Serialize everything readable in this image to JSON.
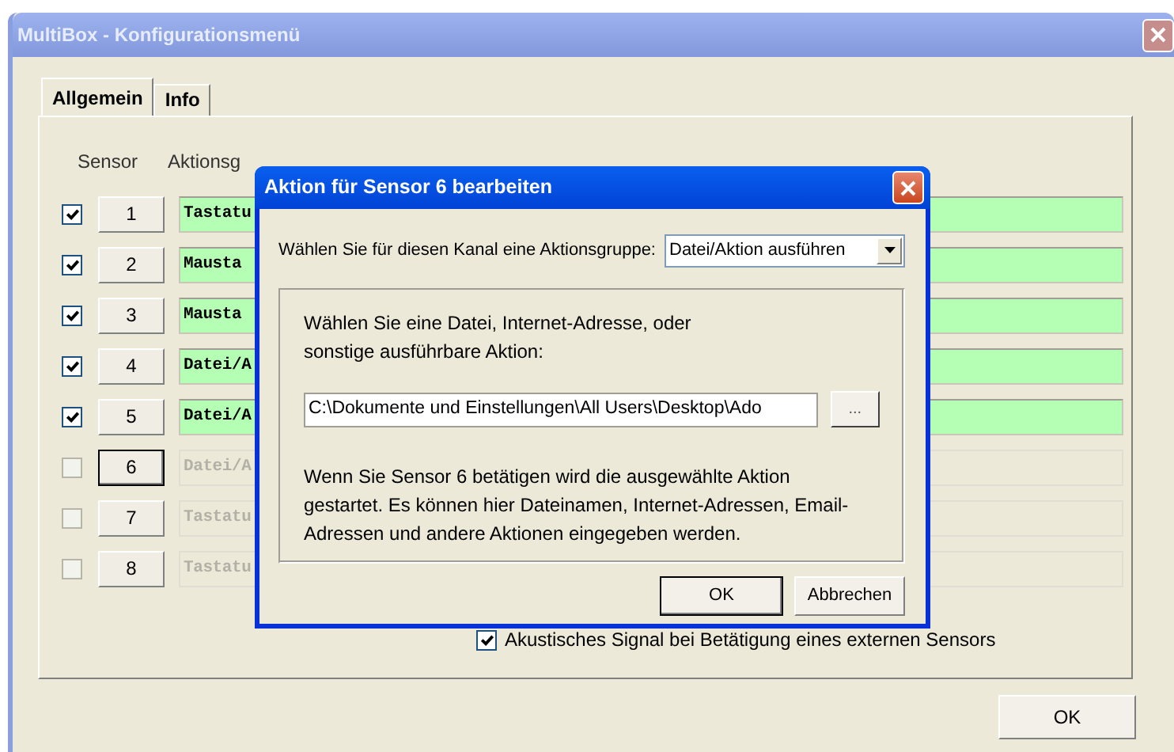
{
  "window": {
    "title": "MultiBox - Konfigurationsmenü"
  },
  "tabs": [
    {
      "label": "Allgemein",
      "selected": true
    },
    {
      "label": "Info",
      "selected": false
    }
  ],
  "columns": [
    "Sensor",
    "Aktionsg"
  ],
  "sensors": [
    {
      "number": "1",
      "checked": true,
      "focused": false,
      "action": "Tastatu"
    },
    {
      "number": "2",
      "checked": true,
      "focused": false,
      "action": "Mausta"
    },
    {
      "number": "3",
      "checked": true,
      "focused": false,
      "action": "Mausta"
    },
    {
      "number": "4",
      "checked": true,
      "focused": false,
      "action": "Datei/A"
    },
    {
      "number": "5",
      "checked": true,
      "focused": false,
      "action": "Datei/A"
    },
    {
      "number": "6",
      "checked": false,
      "focused": true,
      "action": "Datei/A"
    },
    {
      "number": "7",
      "checked": false,
      "focused": false,
      "action": "Tastatu"
    },
    {
      "number": "8",
      "checked": false,
      "focused": false,
      "action": "Tastatu"
    }
  ],
  "sound_signal": {
    "label": "Akustisches Signal bei Betätigung eines externen Sensors",
    "checked": true
  },
  "ok_button": "OK",
  "dialog": {
    "title": "Aktion für Sensor 6 bearbeiten",
    "group_label": "Wählen Sie für diesen Kanal eine Aktionsgruppe:",
    "group_value": "Datei/Aktion ausführen",
    "instruction": "Wählen Sie eine Datei, Internet-Adresse, oder sonstige ausführbare Aktion:",
    "path_value": "C:\\Dokumente und Einstellungen\\All Users\\Desktop\\Ado",
    "browse_button": "...",
    "description": "Wenn Sie Sensor 6 betätigen wird die ausgewählte Aktion gestartet. Es können hier Dateinamen, Internet-Adressen, Email-Adressen und andere Aktionen eingegeben werden.",
    "buttons": [
      "OK",
      "Abbrechen"
    ]
  }
}
